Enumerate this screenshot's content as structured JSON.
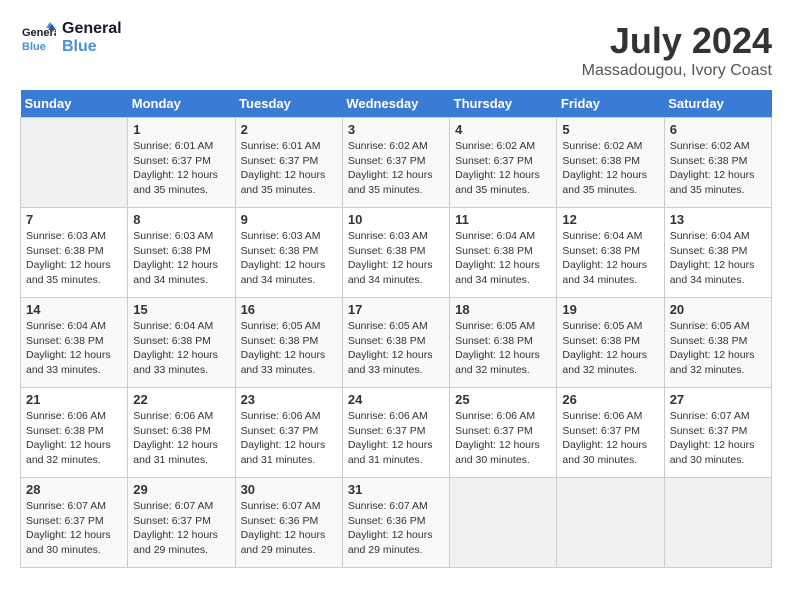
{
  "header": {
    "logo_line1": "General",
    "logo_line2": "Blue",
    "month_year": "July 2024",
    "location": "Massadougou, Ivory Coast"
  },
  "days_of_week": [
    "Sunday",
    "Monday",
    "Tuesday",
    "Wednesday",
    "Thursday",
    "Friday",
    "Saturday"
  ],
  "weeks": [
    [
      {
        "day": "",
        "info": ""
      },
      {
        "day": "1",
        "info": "Sunrise: 6:01 AM\nSunset: 6:37 PM\nDaylight: 12 hours\nand 35 minutes."
      },
      {
        "day": "2",
        "info": "Sunrise: 6:01 AM\nSunset: 6:37 PM\nDaylight: 12 hours\nand 35 minutes."
      },
      {
        "day": "3",
        "info": "Sunrise: 6:02 AM\nSunset: 6:37 PM\nDaylight: 12 hours\nand 35 minutes."
      },
      {
        "day": "4",
        "info": "Sunrise: 6:02 AM\nSunset: 6:37 PM\nDaylight: 12 hours\nand 35 minutes."
      },
      {
        "day": "5",
        "info": "Sunrise: 6:02 AM\nSunset: 6:38 PM\nDaylight: 12 hours\nand 35 minutes."
      },
      {
        "day": "6",
        "info": "Sunrise: 6:02 AM\nSunset: 6:38 PM\nDaylight: 12 hours\nand 35 minutes."
      }
    ],
    [
      {
        "day": "7",
        "info": ""
      },
      {
        "day": "8",
        "info": "Sunrise: 6:03 AM\nSunset: 6:38 PM\nDaylight: 12 hours\nand 34 minutes."
      },
      {
        "day": "9",
        "info": "Sunrise: 6:03 AM\nSunset: 6:38 PM\nDaylight: 12 hours\nand 34 minutes."
      },
      {
        "day": "10",
        "info": "Sunrise: 6:03 AM\nSunset: 6:38 PM\nDaylight: 12 hours\nand 34 minutes."
      },
      {
        "day": "11",
        "info": "Sunrise: 6:04 AM\nSunset: 6:38 PM\nDaylight: 12 hours\nand 34 minutes."
      },
      {
        "day": "12",
        "info": "Sunrise: 6:04 AM\nSunset: 6:38 PM\nDaylight: 12 hours\nand 34 minutes."
      },
      {
        "day": "13",
        "info": "Sunrise: 6:04 AM\nSunset: 6:38 PM\nDaylight: 12 hours\nand 34 minutes."
      }
    ],
    [
      {
        "day": "14",
        "info": ""
      },
      {
        "day": "15",
        "info": "Sunrise: 6:04 AM\nSunset: 6:38 PM\nDaylight: 12 hours\nand 33 minutes."
      },
      {
        "day": "16",
        "info": "Sunrise: 6:05 AM\nSunset: 6:38 PM\nDaylight: 12 hours\nand 33 minutes."
      },
      {
        "day": "17",
        "info": "Sunrise: 6:05 AM\nSunset: 6:38 PM\nDaylight: 12 hours\nand 33 minutes."
      },
      {
        "day": "18",
        "info": "Sunrise: 6:05 AM\nSunset: 6:38 PM\nDaylight: 12 hours\nand 32 minutes."
      },
      {
        "day": "19",
        "info": "Sunrise: 6:05 AM\nSunset: 6:38 PM\nDaylight: 12 hours\nand 32 minutes."
      },
      {
        "day": "20",
        "info": "Sunrise: 6:05 AM\nSunset: 6:38 PM\nDaylight: 12 hours\nand 32 minutes."
      }
    ],
    [
      {
        "day": "21",
        "info": ""
      },
      {
        "day": "22",
        "info": "Sunrise: 6:06 AM\nSunset: 6:38 PM\nDaylight: 12 hours\nand 31 minutes."
      },
      {
        "day": "23",
        "info": "Sunrise: 6:06 AM\nSunset: 6:37 PM\nDaylight: 12 hours\nand 31 minutes."
      },
      {
        "day": "24",
        "info": "Sunrise: 6:06 AM\nSunset: 6:37 PM\nDaylight: 12 hours\nand 31 minutes."
      },
      {
        "day": "25",
        "info": "Sunrise: 6:06 AM\nSunset: 6:37 PM\nDaylight: 12 hours\nand 30 minutes."
      },
      {
        "day": "26",
        "info": "Sunrise: 6:06 AM\nSunset: 6:37 PM\nDaylight: 12 hours\nand 30 minutes."
      },
      {
        "day": "27",
        "info": "Sunrise: 6:07 AM\nSunset: 6:37 PM\nDaylight: 12 hours\nand 30 minutes."
      }
    ],
    [
      {
        "day": "28",
        "info": "Sunrise: 6:07 AM\nSunset: 6:37 PM\nDaylight: 12 hours\nand 30 minutes."
      },
      {
        "day": "29",
        "info": "Sunrise: 6:07 AM\nSunset: 6:37 PM\nDaylight: 12 hours\nand 29 minutes."
      },
      {
        "day": "30",
        "info": "Sunrise: 6:07 AM\nSunset: 6:36 PM\nDaylight: 12 hours\nand 29 minutes."
      },
      {
        "day": "31",
        "info": "Sunrise: 6:07 AM\nSunset: 6:36 PM\nDaylight: 12 hours\nand 29 minutes."
      },
      {
        "day": "",
        "info": ""
      },
      {
        "day": "",
        "info": ""
      },
      {
        "day": "",
        "info": ""
      }
    ]
  ],
  "week1_day7_info": "Sunrise: 6:03 AM\nSunset: 6:38 PM\nDaylight: 12 hours\nand 35 minutes.",
  "week2_day14_info": "Sunrise: 6:04 AM\nSunset: 6:38 PM\nDaylight: 12 hours\nand 33 minutes.",
  "week3_day21_info": "Sunrise: 6:06 AM\nSunset: 6:38 PM\nDaylight: 12 hours\nand 32 minutes."
}
